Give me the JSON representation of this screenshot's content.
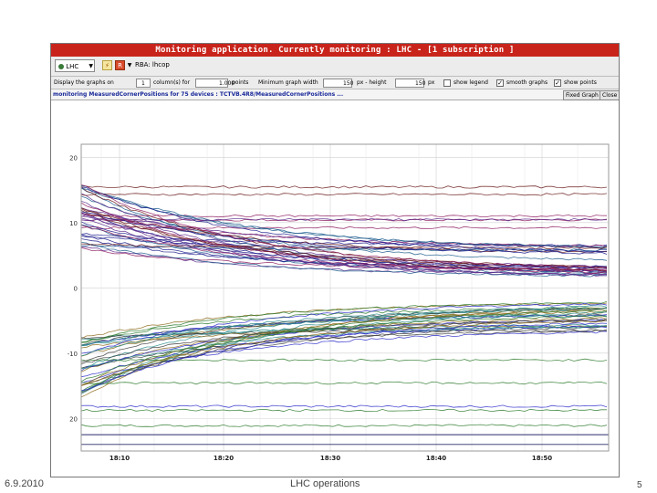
{
  "window": {
    "title": "Monitoring application. Currently monitoring : LHC - [1 subscription ]"
  },
  "toolbar": {
    "combo_value": "LHC",
    "rbac_label": "RBA: lhcop"
  },
  "options": {
    "display_label": "Display the graphs on",
    "columns_value": "1",
    "columns_label": "column(s) for",
    "points_value": "1.000",
    "points_label": "points",
    "min_width_label": "Minimum graph width",
    "min_width_value": "150",
    "height_label": "px - height",
    "height_value": "150",
    "px_label": "px",
    "show_legend_label": "show legend",
    "smooth_label": "smooth graphs",
    "show_points_label": "show points",
    "show_legend_checked": false,
    "smooth_checked": true,
    "show_points_checked": true
  },
  "subscription": {
    "description": "monitoring MeasuredCornerPositions for 75 devices : TCTVB.4R8/MeasuredCornerPositions ...",
    "fixed_graph_label": "Fixed Graph",
    "close_label": "Close"
  },
  "chart_data": {
    "type": "line",
    "y_ticks": [
      "20",
      "10",
      "0",
      "-10",
      "20"
    ],
    "x_ticks": [
      "18:10",
      "18:20",
      "18:30",
      "18:40",
      "18:50"
    ],
    "ylim": [
      -25,
      22
    ],
    "grid": true,
    "legend": "none",
    "series_count": 75,
    "series_description": "collimator jaw corner positions converging over time",
    "colors": [
      "#1a1a8c",
      "#2c7a2c",
      "#8c1a5e",
      "#2a8c8c",
      "#5a2a8c",
      "#8c6a1a",
      "#1a5a8c",
      "#3c3c3c",
      "#6a1a1a",
      "#2a2aca"
    ]
  },
  "slide": {
    "date": "6.9.2010",
    "footer": "LHC operations",
    "page": "5"
  }
}
